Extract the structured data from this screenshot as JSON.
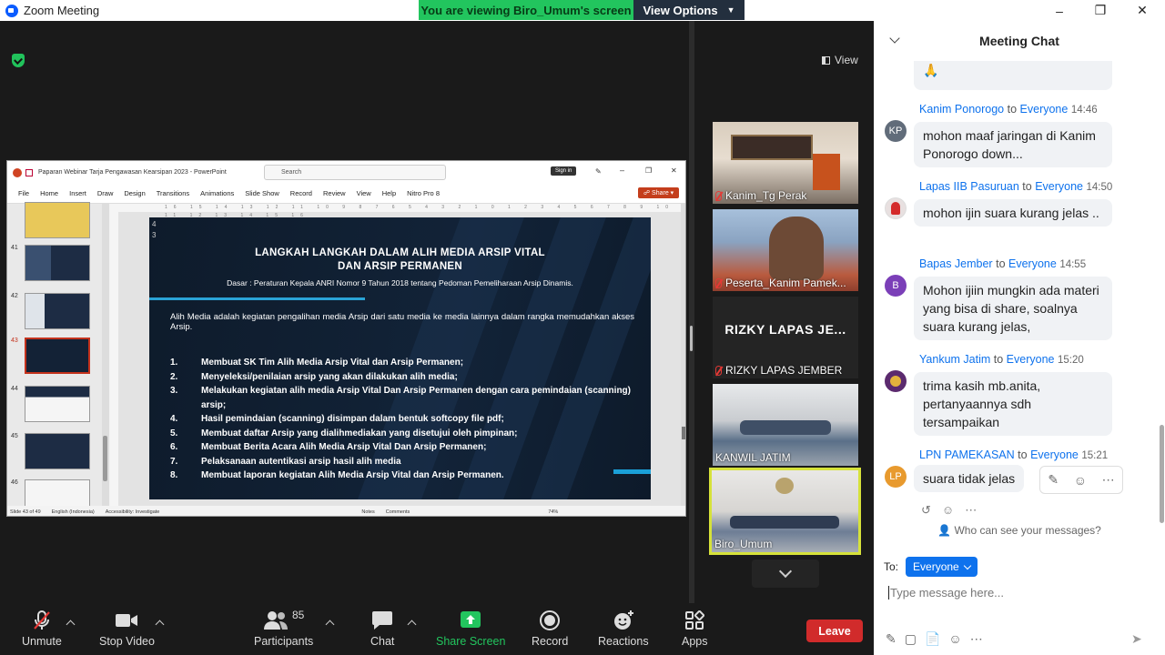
{
  "window": {
    "title": "Zoom Meeting"
  },
  "banner": {
    "viewing": "You are viewing Biro_Umum's screen",
    "view_options": "View Options"
  },
  "stage": {
    "view_label": "View"
  },
  "ppt": {
    "title": "Paparan Webinar Tarja Pengawasan Kearsipan 2023  -  PowerPoint",
    "search_placeholder": "Search",
    "sign_in": "Sign in",
    "menu": [
      "File",
      "Home",
      "Insert",
      "Draw",
      "Design",
      "Transitions",
      "Animations",
      "Slide Show",
      "Record",
      "Review",
      "View",
      "Help",
      "Nitro Pro 8"
    ],
    "share": "Share",
    "thumbs": [
      "41",
      "42",
      "43",
      "44",
      "45",
      "46"
    ],
    "ruler": "16 15 14 13 12 11 10 9 8 7 6 5 4 3 2 1 0 1 2 3 4 5 6 7 8 9 10 11 12 13 14 15 16",
    "slide": {
      "page_nums": "4\n3",
      "heading_line1": "LANGKAH LANGKAH DALAM ALIH MEDIA ARSIP VITAL",
      "heading_line2": "DAN ARSIP PERMANEN",
      "dasar": "Dasar : Peraturan Kepala ANRI Nomor 9 Tahun 2018 tentang Pedoman Pemeliharaan Arsip Dinamis.",
      "intro": "Alih Media adalah kegiatan pengalihan media Arsip dari satu media ke media lainnya dalam rangka memudahkan akses Arsip.",
      "steps": [
        {
          "n": "1.",
          "t": "Membuat SK Tim Alih Media Arsip Vital dan Arsip Permanen;"
        },
        {
          "n": "2.",
          "t": "Menyeleksi/penilaian arsip yang akan dilakukan alih media;"
        },
        {
          "n": "3.",
          "t": "Melakukan kegiatan alih media Arsip Vital Dan Arsip Permanen dengan cara pemindaian (scanning) arsip;"
        },
        {
          "n": "4.",
          "t": "Hasil pemindaian (scanning) disimpan dalam bentuk softcopy file pdf;"
        },
        {
          "n": "5.",
          "t": "Membuat daftar Arsip yang dialihmediakan yang disetujui oleh pimpinan;"
        },
        {
          "n": "6.",
          "t": "Membuat Berita Acara Alih Media Arsip Vital Dan Arsip Permanen;"
        },
        {
          "n": "7.",
          "t": "Pelaksanaan autentikasi arsip hasil alih media"
        },
        {
          "n": "8.",
          "t": "Membuat laporan kegiatan Alih Media Arsip Vital dan Arsip Permanen."
        }
      ]
    },
    "status": {
      "slide": "Slide 43 of 49",
      "lang": "English (Indonesia)",
      "access": "Accessibility: Investigate",
      "notes": "Notes",
      "comments": "Comments",
      "zoom": "74%"
    }
  },
  "participants": [
    {
      "name": "Kanim_Tg Perak",
      "muted": true
    },
    {
      "name": "Peserta_Kanim Pamek...",
      "muted": true
    },
    {
      "name": "RIZKY LAPAS JEMBER",
      "muted": true,
      "big": "RIZKY LAPAS JE..."
    },
    {
      "name": "KANWIL JATIM",
      "muted": false
    },
    {
      "name": "Biro_Umum",
      "muted": false
    }
  ],
  "toolbar": {
    "unmute": "Unmute",
    "stop_video": "Stop Video",
    "participants": "Participants",
    "participant_count": "85",
    "chat": "Chat",
    "share_screen": "Share Screen",
    "record": "Record",
    "reactions": "Reactions",
    "apps": "Apps",
    "leave": "Leave"
  },
  "chat": {
    "title": "Meeting Chat",
    "messages": [
      {
        "initials": "KP",
        "sender": "Kanim Ponorogo",
        "to": "to",
        "target": "Everyone",
        "time": "14:46",
        "text": "mohon maaf jaringan di Kanim Ponorogo down..."
      },
      {
        "initials": "",
        "sender": "Lapas IIB Pasuruan",
        "to": "to",
        "target": "Everyone",
        "time": "14:50",
        "text": "mohon ijin suara kurang jelas .."
      },
      {
        "initials": "B",
        "sender": "Bapas Jember",
        "to": "to",
        "target": "Everyone",
        "time": "14:55",
        "text": "Mohon ijiin mungkin ada materi yang bisa di share, soalnya suara kurang jelas,"
      },
      {
        "initials": "",
        "sender": "Yankum Jatim",
        "to": "to",
        "target": "Everyone",
        "time": "15:20",
        "text": "trima kasih mb.anita, pertanyaannya sdh tersampaikan"
      },
      {
        "initials": "LP",
        "sender": "LPN PAMEKASAN",
        "to": "to",
        "target": "Everyone",
        "time": "15:21",
        "text": "suara tidak jelas"
      }
    ],
    "who_can_see": "Who can see your messages?",
    "to_label": "To:",
    "recipient": "Everyone",
    "input_placeholder": "Type message here..."
  },
  "colors": {
    "accent": "#0e72ed",
    "leave": "#d12b2b",
    "share": "#22c55e"
  }
}
